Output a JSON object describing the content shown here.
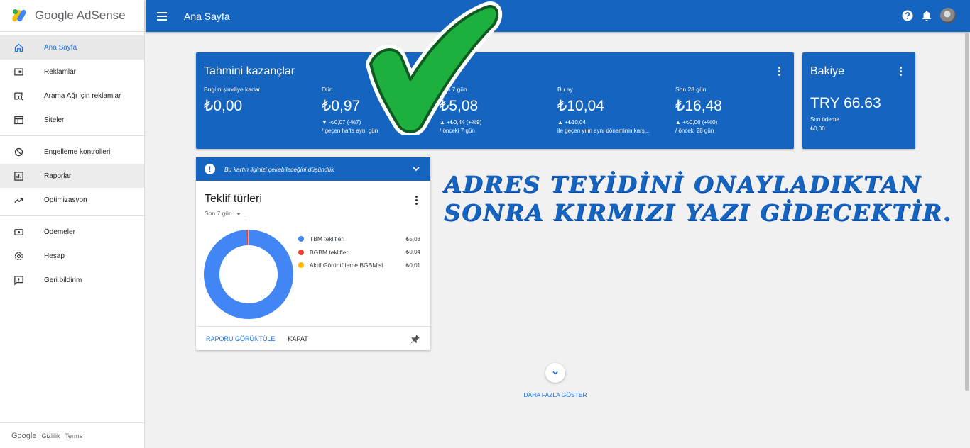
{
  "sidebar": {
    "brand": "Google AdSense",
    "groups": [
      [
        {
          "label": "Ana Sayfa",
          "icon": "home-icon",
          "active": true
        },
        {
          "label": "Reklamlar",
          "icon": "ad-icon"
        },
        {
          "label": "Arama Ağı için reklamlar",
          "icon": "search-ads-icon"
        },
        {
          "label": "Siteler",
          "icon": "sites-icon"
        }
      ],
      [
        {
          "label": "Engelleme kontrolleri",
          "icon": "block-icon"
        },
        {
          "label": "Raporlar",
          "icon": "reports-icon"
        },
        {
          "label": "Optimizasyon",
          "icon": "trend-icon"
        }
      ],
      [
        {
          "label": "Ödemeler",
          "icon": "payments-icon"
        },
        {
          "label": "Hesap",
          "icon": "gear-icon"
        },
        {
          "label": "Geri bildirim",
          "icon": "feedback-icon"
        }
      ]
    ],
    "footer": {
      "google": "Google",
      "privacy": "Gizlilik",
      "terms": "Terms"
    }
  },
  "topbar": {
    "title": "Ana Sayfa"
  },
  "earnings": {
    "title": "Tahmini kazançlar",
    "columns": [
      {
        "label": "Bugün şimdiye kadar",
        "value": "₺0,00",
        "delta": "",
        "compare": ""
      },
      {
        "label": "Dün",
        "value": "₺0,97",
        "delta": "▼ -₺0,07 (-%7)",
        "compare": "/ geçen hafta aynı gün"
      },
      {
        "label": "Son 7 gün",
        "value": "₺5,08",
        "delta": "▲ +₺0,44 (+%9)",
        "compare": "/ önceki 7 gün"
      },
      {
        "label": "Bu ay",
        "value": "₺10,04",
        "delta": "▲ +₺10,04",
        "compare": "ile geçen yılın aynı döneminin karş..."
      },
      {
        "label": "Son 28 gün",
        "value": "₺16,48",
        "delta": "▲ +₺0,06 (+%0)",
        "compare": "/ önceki 28 gün"
      }
    ]
  },
  "balance": {
    "title": "Bakiye",
    "amount": "TRY 66.63",
    "last_label": "Son ödeme",
    "last_value": "₺0,00"
  },
  "offer": {
    "notice": "Bu kartın ilginizi çekebileceğini düşündük",
    "title": "Teklif türleri",
    "period": "Son 7 gün",
    "items": [
      {
        "label": "TBM teklifleri",
        "value": "₺5,03",
        "amount": 5.03,
        "color": "#4285f4"
      },
      {
        "label": "BGBM teklifleri",
        "value": "₺0,04",
        "amount": 0.04,
        "color": "#ea4335"
      },
      {
        "label": "Aktif Görüntüleme BGBM'si",
        "value": "₺0,01",
        "amount": 0.01,
        "color": "#fbbc04"
      }
    ],
    "view_report": "RAPORU GÖRÜNTÜLE",
    "close": "KAPAT"
  },
  "annotation": {
    "line1": "ADRES TEYİDİNİ ONAYLADIKTAN",
    "line2": "SONRA KIRMIZI YAZI GİDECEKTİR."
  },
  "show_more": "DAHA FAZLA GÖSTER",
  "colors": {
    "primary": "#1565c0",
    "accent": "#1a73e8",
    "check": "#1db03f"
  }
}
